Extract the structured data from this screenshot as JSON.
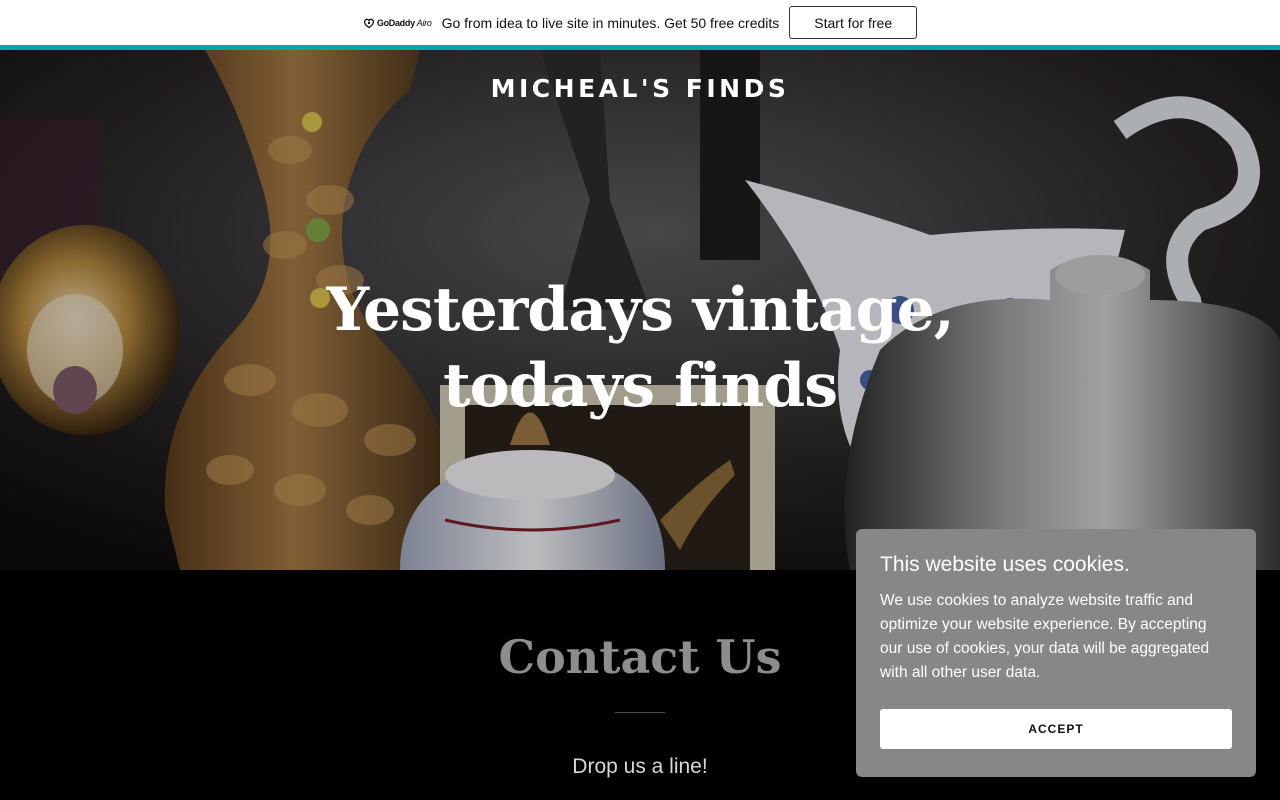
{
  "promo": {
    "logo_text": "GoDaddy",
    "logo_suffix": "Airo",
    "message": "Go from idea to live site in minutes. Get 50 free credits",
    "cta_label": "Start for free",
    "accent_color": "#0aa5a5"
  },
  "hero": {
    "site_title": "MICHEAL'S FINDS",
    "headline": "Yesterdays vintage, todays finds"
  },
  "contact": {
    "title": "Contact Us",
    "subtitle": "Drop us a line!"
  },
  "cookie_banner": {
    "title": "This website uses cookies.",
    "body": "We use cookies to analyze website traffic and optimize your website experience. By accepting our use of cookies, your data will be aggregated with all other user data.",
    "accept_label": "ACCEPT"
  }
}
